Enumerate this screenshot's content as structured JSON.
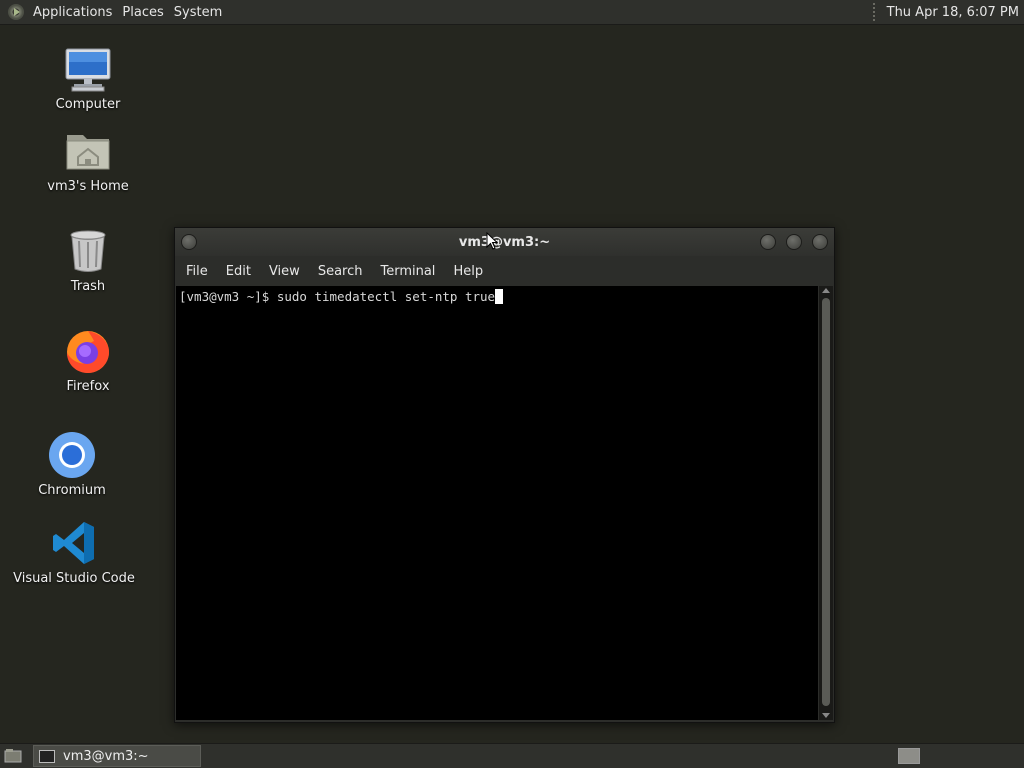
{
  "top_panel": {
    "menu": [
      "Applications",
      "Places",
      "System"
    ],
    "clock": "Thu Apr 18,  6:07 PM"
  },
  "desktop_icons": [
    {
      "label": "Computer",
      "icon": "computer-icon"
    },
    {
      "label": "vm3's Home",
      "icon": "home-folder-icon"
    },
    {
      "label": "Trash",
      "icon": "trash-icon"
    },
    {
      "label": "Firefox",
      "icon": "firefox-icon"
    },
    {
      "label": "Chromium",
      "icon": "chromium-icon"
    },
    {
      "label": "Visual Studio Code",
      "icon": "vscode-icon"
    }
  ],
  "terminal": {
    "title": "vm3@vm3:~",
    "menu": [
      "File",
      "Edit",
      "View",
      "Search",
      "Terminal",
      "Help"
    ],
    "prompt": "[vm3@vm3 ~]$ ",
    "command": "sudo timedatectl set-ntp true"
  },
  "taskbar": {
    "task_label": "vm3@vm3:~"
  },
  "colors": {
    "desktop_bg": "#25261f",
    "panel_bg": "#2f302c",
    "terminal_bg": "#000000"
  }
}
